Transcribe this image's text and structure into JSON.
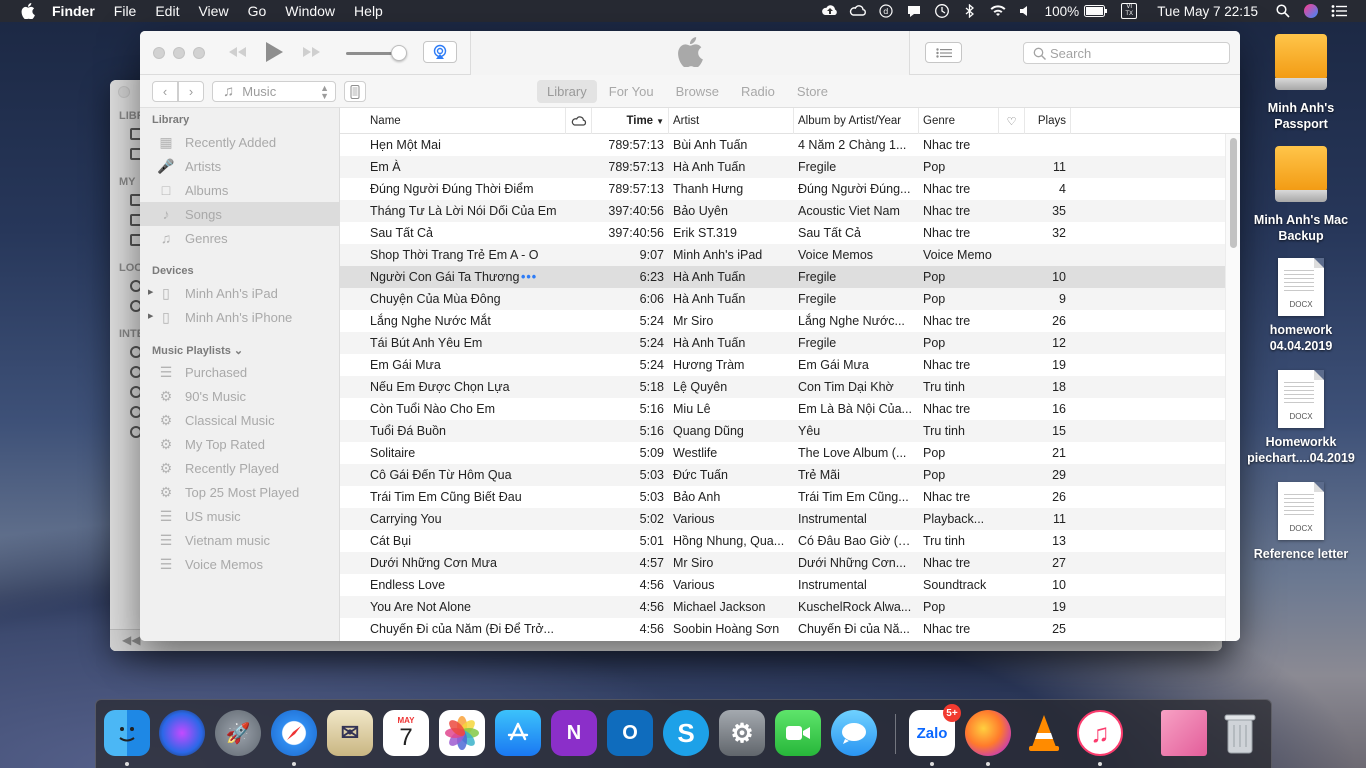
{
  "menubar": {
    "app_name": "Finder",
    "items": [
      "File",
      "Edit",
      "View",
      "Go",
      "Window",
      "Help"
    ],
    "battery": "100%",
    "input_badge": "VI TX",
    "clock": "Tue May 7  22:15"
  },
  "finder_bg": {
    "section_labels": [
      "LIBR",
      "MY",
      "LOC",
      "INTE"
    ]
  },
  "itunes": {
    "search_placeholder": "Search",
    "media_kind": "Music",
    "tabs": [
      "Library",
      "For You",
      "Browse",
      "Radio",
      "Store"
    ],
    "active_tab": "Library",
    "sidebar": {
      "library_header": "Library",
      "library_items": [
        "Recently Added",
        "Artists",
        "Albums",
        "Songs",
        "Genres"
      ],
      "selected_item": "Songs",
      "devices_header": "Devices",
      "devices": [
        "Minh Anh's iPad",
        "Minh Anh's iPhone"
      ],
      "playlists_header": "Music Playlists ⌄",
      "playlists": [
        "Purchased",
        "90's Music",
        "Classical Music",
        "My Top Rated",
        "Recently Played",
        "Top 25 Most Played",
        "US music",
        "Vietnam music",
        "Voice Memos"
      ]
    },
    "columns": {
      "name": "Name",
      "time": "Time",
      "artist": "Artist",
      "album": "Album by Artist/Year",
      "genre": "Genre",
      "plays": "Plays"
    },
    "songs": [
      {
        "name": "Hẹn Một Mai",
        "time": "789:57:13",
        "artist": "Bùi Anh Tuấn",
        "album": "4 Năm 2 Chàng 1...",
        "genre": "Nhac tre",
        "plays": ""
      },
      {
        "name": "Em À",
        "time": "789:57:13",
        "artist": "Hà Anh Tuấn",
        "album": "Fregile",
        "genre": "Pop",
        "plays": "11"
      },
      {
        "name": "Đúng Người Đúng Thời Điểm",
        "time": "789:57:13",
        "artist": "Thanh Hưng",
        "album": "Đúng Người Đúng...",
        "genre": "Nhac tre",
        "plays": "4"
      },
      {
        "name": "Tháng Tư Là Lời Nói Dối Của Em",
        "time": "397:40:56",
        "artist": "Bảo Uyên",
        "album": "Acoustic Viet Nam",
        "genre": "Nhac tre",
        "plays": "35"
      },
      {
        "name": "Sau Tất Cả",
        "time": "397:40:56",
        "artist": "Erik ST.319",
        "album": "Sau Tất Cả",
        "genre": "Nhac tre",
        "plays": "32"
      },
      {
        "name": "Shop Thời Trang Trẻ Em A - O",
        "time": "9:07",
        "artist": "Minh Anh's iPad",
        "album": "Voice Memos",
        "genre": "Voice Memo",
        "plays": ""
      },
      {
        "name": "Người Con Gái Ta Thương",
        "time": "6:23",
        "artist": "Hà Anh Tuấn",
        "album": "Fregile",
        "genre": "Pop",
        "plays": "10",
        "playing": true
      },
      {
        "name": "Chuyện Của Mùa Đông",
        "time": "6:06",
        "artist": "Hà Anh Tuấn",
        "album": "Fregile",
        "genre": "Pop",
        "plays": "9"
      },
      {
        "name": "Lắng Nghe Nước Mắt",
        "time": "5:24",
        "artist": "Mr Siro",
        "album": "Lắng Nghe Nước...",
        "genre": "Nhac tre",
        "plays": "26"
      },
      {
        "name": "Tái Bút Anh Yêu Em",
        "time": "5:24",
        "artist": "Hà Anh Tuấn",
        "album": "Fregile",
        "genre": "Pop",
        "plays": "12"
      },
      {
        "name": "Em Gái Mưa",
        "time": "5:24",
        "artist": "Hương Tràm",
        "album": "Em Gái Mưa",
        "genre": "Nhac tre",
        "plays": "19"
      },
      {
        "name": "Nếu Em Được Chọn Lựa",
        "time": "5:18",
        "artist": "Lệ Quyên",
        "album": "Con Tim Dại Khờ",
        "genre": "Tru tinh",
        "plays": "18"
      },
      {
        "name": "Còn Tuổi Nào Cho Em",
        "time": "5:16",
        "artist": "Miu Lê",
        "album": "Em Là Bà Nội Của...",
        "genre": "Nhac tre",
        "plays": "16"
      },
      {
        "name": "Tuổi Đá Buồn",
        "time": "5:16",
        "artist": "Quang Dũng",
        "album": "Yêu",
        "genre": "Tru tinh",
        "plays": "15"
      },
      {
        "name": "Solitaire",
        "time": "5:09",
        "artist": "Westlife",
        "album": "The Love Album (...",
        "genre": "Pop",
        "plays": "21"
      },
      {
        "name": "Cô Gái Đến Từ Hôm Qua",
        "time": "5:03",
        "artist": "Đức Tuấn",
        "album": "Trẻ Mãi",
        "genre": "Pop",
        "plays": "29"
      },
      {
        "name": "Trái Tim Em Cũng Biết Đau",
        "time": "5:03",
        "artist": "Bảo Anh",
        "album": "Trái Tim Em Cũng...",
        "genre": "Nhac tre",
        "plays": "26"
      },
      {
        "name": "Carrying You",
        "time": "5:02",
        "artist": "Various",
        "album": "Instrumental",
        "genre": "Playback...",
        "plays": "11"
      },
      {
        "name": "Cát Bụi",
        "time": "5:01",
        "artist": "Hồng Nhung, Qua...",
        "album": "Có Đâu Bao Giờ (N...",
        "genre": "Tru tinh",
        "plays": "13"
      },
      {
        "name": "Dưới Những Cơn Mưa",
        "time": "4:57",
        "artist": "Mr Siro",
        "album": "Dưới Những Cơn...",
        "genre": "Nhac tre",
        "plays": "27"
      },
      {
        "name": "Endless Love",
        "time": "4:56",
        "artist": "Various",
        "album": "Instrumental",
        "genre": "Soundtrack",
        "plays": "10"
      },
      {
        "name": "You Are Not Alone",
        "time": "4:56",
        "artist": "Michael Jackson",
        "album": "KuschelRock Alwa...",
        "genre": "Pop",
        "plays": "19"
      },
      {
        "name": "Chuyến Đi của Năm (Đi Để Trở...",
        "time": "4:56",
        "artist": "Soobin Hoàng Sơn",
        "album": "Chuyến Đi của Nă...",
        "genre": "Nhac tre",
        "plays": "25"
      }
    ]
  },
  "desktop": {
    "icons": [
      {
        "label": "Minh Anh's Passport",
        "kind": "drive"
      },
      {
        "label": "Minh Anh's Mac Backup",
        "kind": "drive"
      },
      {
        "label": "homework 04.04.2019",
        "kind": "docx",
        "tag": "DOCX"
      },
      {
        "label": "Homeworkk piechart....04.2019",
        "kind": "docx",
        "tag": "DOCX"
      },
      {
        "label": "Reference letter",
        "kind": "docx",
        "tag": "DOCX"
      }
    ]
  },
  "dock": {
    "apps": [
      "Finder",
      "Siri",
      "Launchpad",
      "Safari",
      "Mail",
      "Calendar",
      "Photos",
      "App Store",
      "OneNote",
      "Outlook",
      "Skype",
      "System Preferences",
      "FaceTime",
      "Messages",
      "Zalo",
      "Firefox",
      "VLC",
      "iTunes",
      "Preview",
      "Trash"
    ],
    "calendar_month": "MAY",
    "calendar_day": "7",
    "zalo_badge": "5+",
    "zalo_label": "Zalo"
  },
  "colors": {
    "accent_blue": "#2e7cf6",
    "selection_gray": "#dcdcdc",
    "drive_orange": "#f29a12"
  }
}
